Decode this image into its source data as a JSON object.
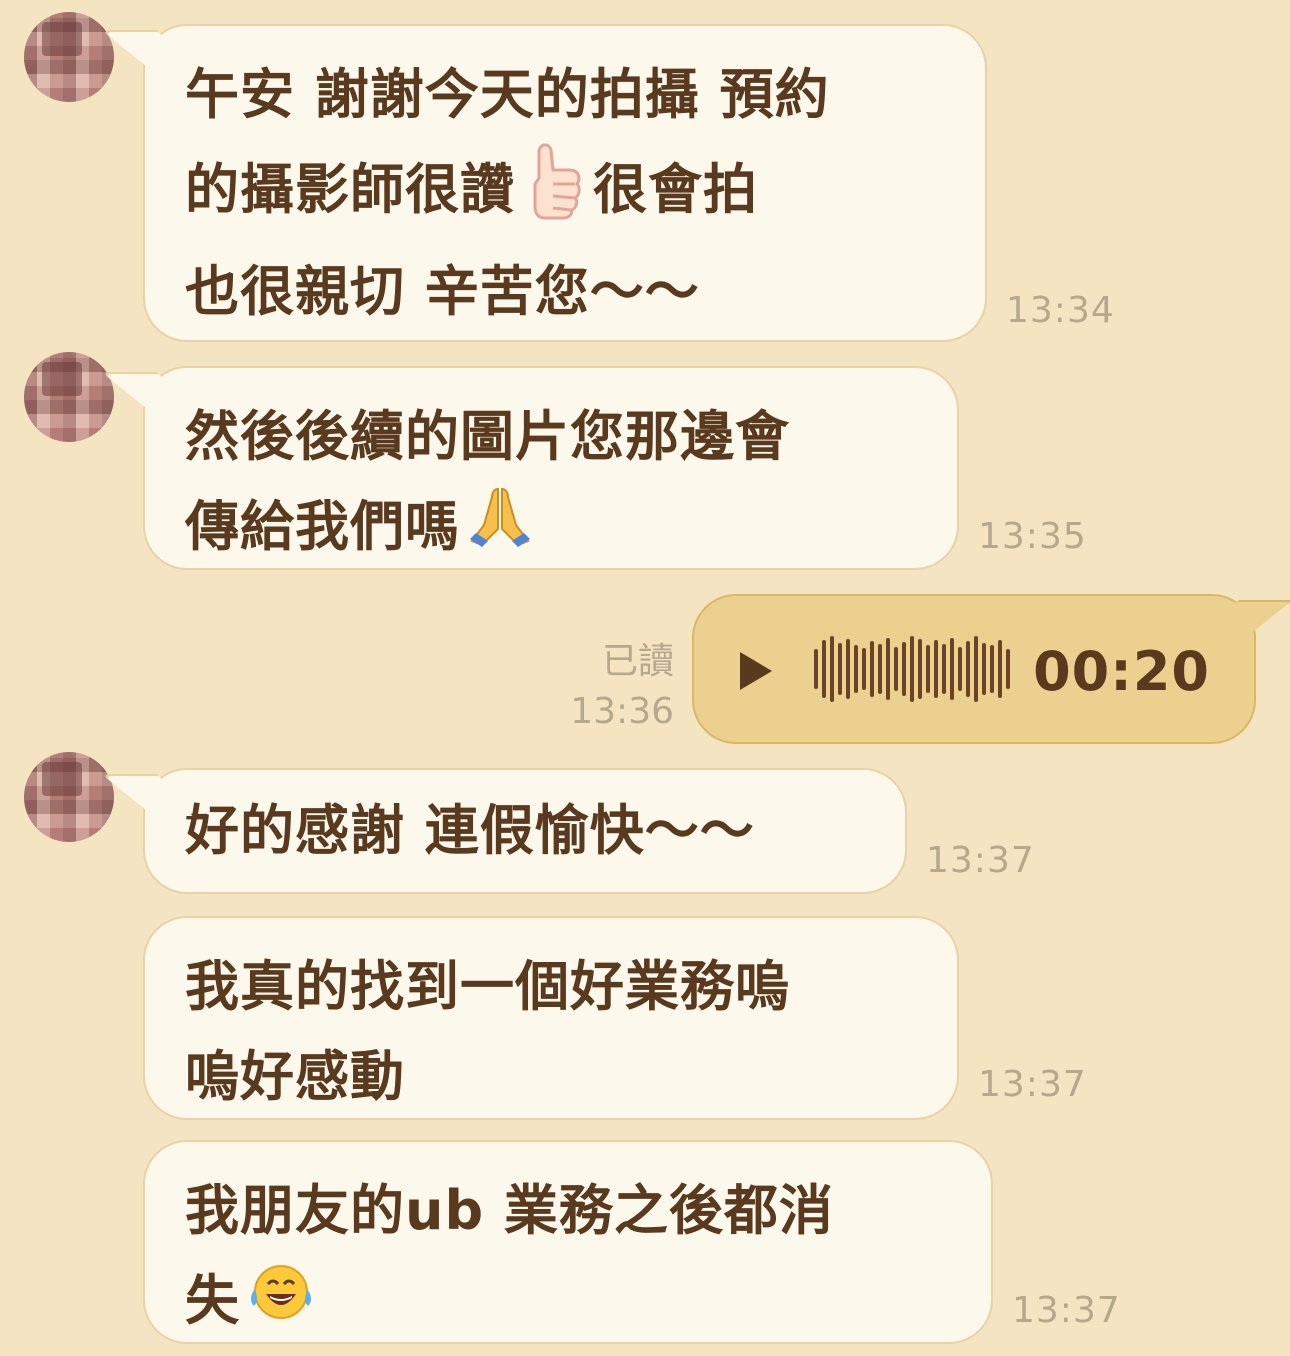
{
  "messages": [
    {
      "lines": [
        "午安 謝謝今天的拍攝 預約",
        "的攝影師很讚",
        "很會拍",
        "也很親切 辛苦您～～"
      ],
      "time": "13:34",
      "emoji": "thumbs-up-icon"
    },
    {
      "lines": [
        "然後後續的圖片您那邊會",
        "傳給我們嗎"
      ],
      "time": "13:35",
      "emoji": "folded-hands-icon"
    },
    {
      "read_label": "已讀",
      "time": "13:36",
      "voice_duration": "00:20"
    },
    {
      "lines": [
        "好的感謝 連假愉快～～"
      ],
      "time": "13:37"
    },
    {
      "lines": [
        "我真的找到一個好業務嗚",
        "嗚好感動"
      ],
      "time": "13:37"
    },
    {
      "lines": [
        "我朋友的ub 業務之後都消",
        "失"
      ],
      "time": "13:37",
      "emoji": "tears-of-joy-icon"
    }
  ],
  "colors": {
    "background": "#f4e4c2",
    "bubble_incoming": "#fdf8ec",
    "bubble_outgoing": "#ecd08f",
    "text": "#5a3a1e",
    "timestamp": "#b6a88d"
  }
}
